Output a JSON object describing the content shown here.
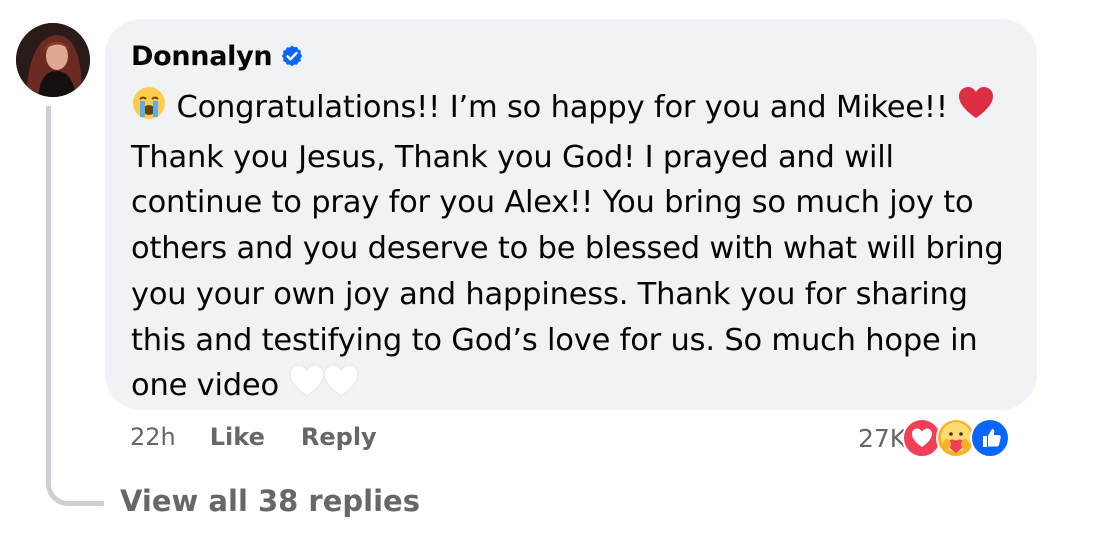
{
  "comment": {
    "author": "Donnalyn",
    "verified": true,
    "avatar_icon": "profile-avatar-icon",
    "text_lines": [
      "Congratulations!! I’m so happy for you and Mikee!!",
      "Thank you Jesus, Thank you God! I prayed and will",
      "continue to pray for you Alex!! You bring so much joy to",
      "others and you deserve to be blessed with what will bring",
      "you your own joy and happiness. Thank you for sharing",
      "this and testifying to God’s love for us. So much hope in",
      "one video"
    ],
    "leading_emoji": "loudly-crying-face-emoji",
    "trailing_emoji_line1": "red-heart-emoji",
    "trailing_emoji_end": [
      "white-heart-emoji",
      "white-heart-emoji"
    ]
  },
  "actions": {
    "time": "22h",
    "like_label": "Like",
    "reply_label": "Reply"
  },
  "reactions": {
    "count": "27K",
    "icons": [
      "love-reaction-icon",
      "care-reaction-icon",
      "like-reaction-icon"
    ]
  },
  "replies": {
    "view_label": "View all 38 replies"
  },
  "colors": {
    "bubble_bg": "#f0f2f5",
    "text_primary": "#050505",
    "text_secondary": "#65676b",
    "verified_blue": "#0866ff",
    "love_red": "#f33e58",
    "like_blue": "#0866ff",
    "thread_line": "#ccd0d5"
  }
}
